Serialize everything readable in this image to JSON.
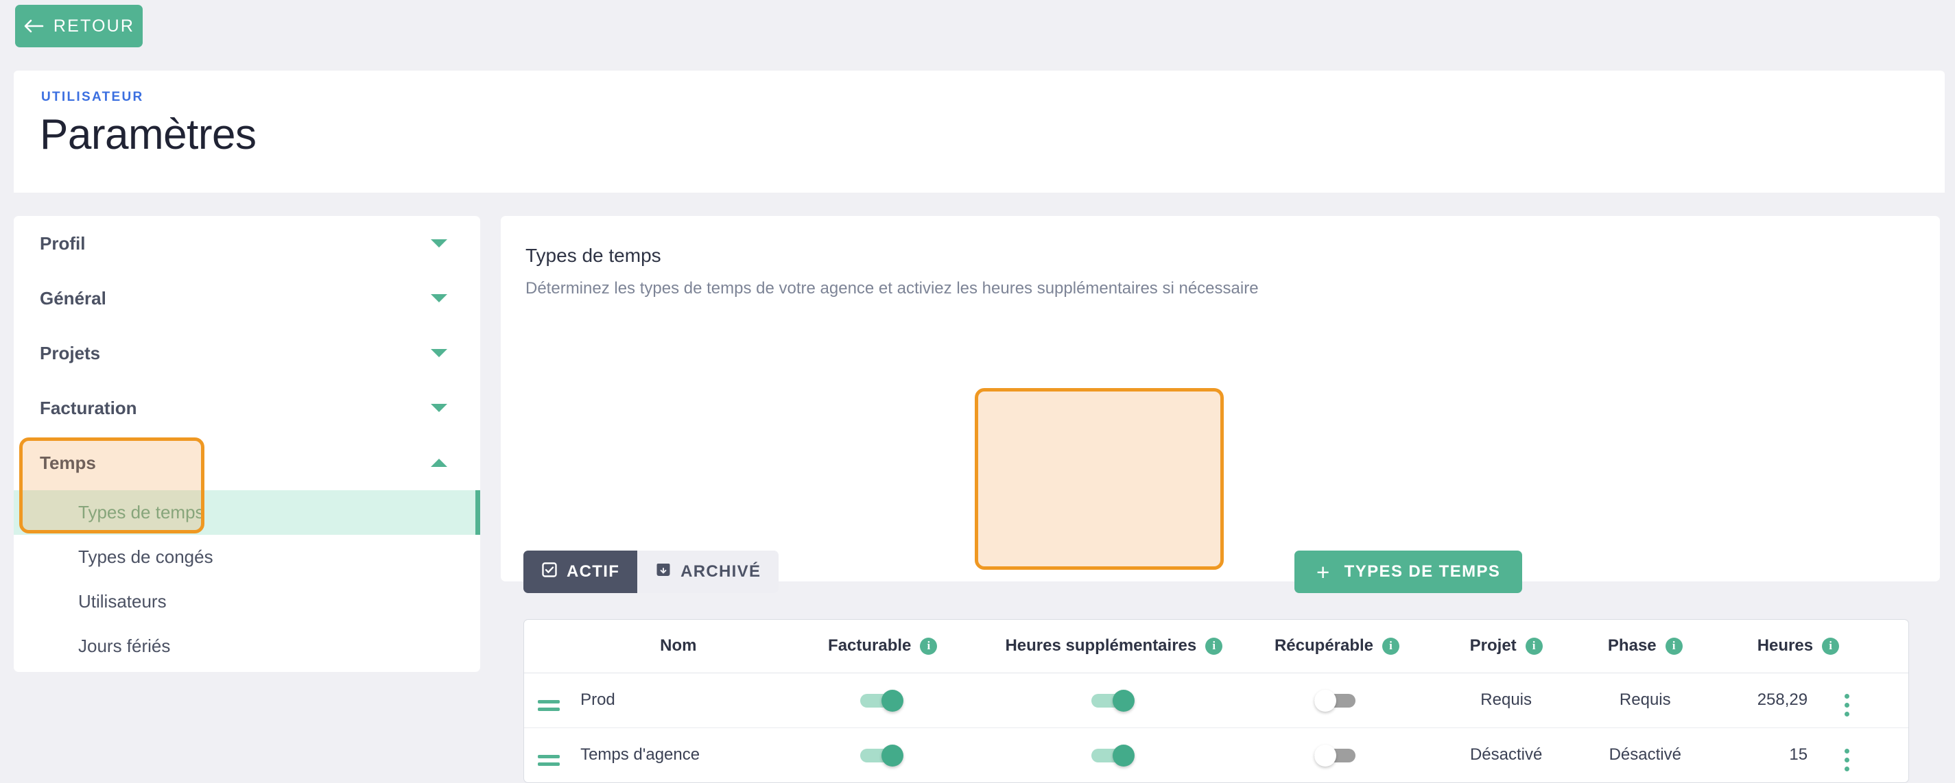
{
  "topbar": {
    "back_label": "RETOUR",
    "back_icon": "arrow-left-icon"
  },
  "header": {
    "eyebrow": "UTILISATEUR",
    "title": "Paramètres"
  },
  "sidebar": {
    "groups": [
      {
        "label": "Profil",
        "chevron": "chevron-down-icon",
        "expanded": false
      },
      {
        "label": "Général",
        "chevron": "chevron-down-icon",
        "expanded": false
      },
      {
        "label": "Projets",
        "chevron": "chevron-down-icon",
        "expanded": false
      },
      {
        "label": "Facturation",
        "chevron": "chevron-down-icon",
        "expanded": false
      },
      {
        "label": "Temps",
        "chevron": "chevron-up-icon",
        "expanded": true
      }
    ],
    "sub_items": [
      {
        "label": "Types de temps",
        "active": true
      },
      {
        "label": "Types de congés",
        "active": false
      },
      {
        "label": "Utilisateurs",
        "active": false
      },
      {
        "label": "Jours fériés",
        "active": false
      }
    ]
  },
  "main": {
    "title": "Types de temps",
    "subtitle": "Déterminez les types de temps de votre agence et activiez les heures supplémentaires si nécessaire",
    "toolbar": {
      "active_label": "ACTIF",
      "active_icon": "checkbox-checked-icon",
      "archived_label": "ARCHIVÉ",
      "archived_icon": "archive-box-icon",
      "add_label": "TYPES DE TEMPS",
      "add_icon": "plus-icon"
    },
    "table": {
      "columns": [
        {
          "key": "handle",
          "label": "",
          "info": false
        },
        {
          "key": "nom",
          "label": "Nom",
          "info": false
        },
        {
          "key": "fact",
          "label": "Facturable",
          "info": true
        },
        {
          "key": "hs",
          "label": "Heures supplémentaires",
          "info": true
        },
        {
          "key": "recup",
          "label": "Récupérable",
          "info": true
        },
        {
          "key": "projet",
          "label": "Projet",
          "info": true
        },
        {
          "key": "phase",
          "label": "Phase",
          "info": true
        },
        {
          "key": "heures",
          "label": "Heures",
          "info": true
        },
        {
          "key": "menu",
          "label": "",
          "info": false
        }
      ],
      "info_glyph": "i",
      "rows": [
        {
          "handle_icon": "drag-handle-icon",
          "nom": "Prod",
          "facturable": true,
          "heures_supplementaires": true,
          "recuperable": false,
          "projet": "Requis",
          "phase": "Requis",
          "heures": "258,29",
          "menu_icon": "kebab-menu-icon"
        },
        {
          "handle_icon": "drag-handle-icon",
          "nom": "Temps d'agence",
          "facturable": true,
          "heures_supplementaires": true,
          "recuperable": false,
          "projet": "Désactivé",
          "phase": "Désactivé",
          "heures": "15",
          "menu_icon": "kebab-menu-icon"
        }
      ]
    }
  },
  "annotations": {
    "sidebar_highlight": "Temps / Types de temps",
    "column_highlight": "Heures supplémentaires",
    "border_color": "#ef9822",
    "fill_color": "rgba(243,152,58,0.22)"
  },
  "colors": {
    "brand_green": "#52b392",
    "page_bg": "#f0f0f4",
    "dark_slate": "#4d5366",
    "eyebrow_blue": "#3b6fe0"
  }
}
